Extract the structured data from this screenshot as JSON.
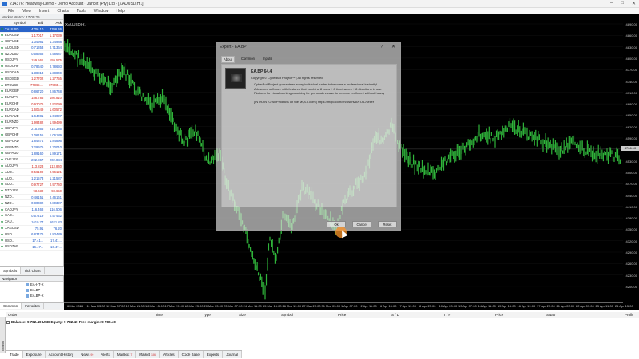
{
  "window": {
    "title": "214376: Headway-Demo - Demo Account - Jancet (Pty) Ltd - [XAUUSD,H1]",
    "controls": [
      "–",
      "□",
      "✕"
    ]
  },
  "menu": [
    "File",
    "View",
    "Insert",
    "Charts",
    "Tools",
    "Window",
    "Help"
  ],
  "market_watch": {
    "title": "Market Watch: 17:00:25",
    "headers": {
      "symbol": "Symbol",
      "bid": "Bid",
      "ask": "Ask"
    },
    "rows": [
      {
        "symbol": "XAUUSD",
        "bid": "4706.10",
        "ask": "4706.46",
        "dir": "sel"
      },
      {
        "symbol": "EURUSD",
        "bid": "1.17017",
        "ask": "1.17039",
        "dir": "down"
      },
      {
        "symbol": "GBPUSD",
        "bid": "1.34981",
        "ask": "1.34988",
        "dir": "up"
      },
      {
        "symbol": "AUDUSD",
        "bid": "0.71353",
        "ask": "0.71364",
        "dir": "up"
      },
      {
        "symbol": "NZDUSD",
        "bid": "0.58668",
        "ask": "0.58687",
        "dir": "up"
      },
      {
        "symbol": "USDJPY",
        "bid": "159.561",
        "ask": "159.575",
        "dir": "down"
      },
      {
        "symbol": "USDCHF",
        "bid": "0.78640",
        "ask": "0.78693",
        "dir": "up"
      },
      {
        "symbol": "USDCAD",
        "bid": "1.38813",
        "ask": "1.38849",
        "dir": "up"
      },
      {
        "symbol": "USDSGD",
        "bid": "1.27702",
        "ask": "1.27755",
        "dir": "down"
      },
      {
        "symbol": "BTCUSD",
        "bid": "77865....",
        "ask": "77903....",
        "dir": "down"
      },
      {
        "symbol": "EURGBP",
        "bid": "0.86720",
        "ask": "0.86748",
        "dir": "up"
      },
      {
        "symbol": "EURJPY",
        "bid": "186.785",
        "ask": "186.810",
        "dir": "down"
      },
      {
        "symbol": "EURCHF",
        "bid": "0.92076",
        "ask": "0.92099",
        "dir": "down"
      },
      {
        "symbol": "EURCAD",
        "bid": "1.60549",
        "ask": "1.60572",
        "dir": "down"
      },
      {
        "symbol": "EURAUD",
        "bid": "1.64081",
        "ask": "1.64097",
        "dir": "up"
      },
      {
        "symbol": "EURNZD",
        "bid": "1.99482",
        "ask": "1.99499",
        "dir": "down"
      },
      {
        "symbol": "GBPJPY",
        "bid": "215.366",
        "ask": "215.385",
        "dir": "up"
      },
      {
        "symbol": "GBPCHF",
        "bid": "1.06155",
        "ask": "1.06189",
        "dir": "up"
      },
      {
        "symbol": "GBPCAD",
        "bid": "1.84874",
        "ask": "1.84896",
        "dir": "up"
      },
      {
        "symbol": "GBPNZD",
        "bid": "2.29975",
        "ask": "2.30010",
        "dir": "up"
      },
      {
        "symbol": "GBPAUD",
        "bid": "1.89160",
        "ask": "1.89171",
        "dir": "up"
      },
      {
        "symbol": "CHFJPY",
        "bid": "202.867",
        "ask": "202.884",
        "dir": "up"
      },
      {
        "symbol": "AUDJPY",
        "bid": "113.823",
        "ask": "113.840",
        "dir": "down"
      },
      {
        "symbol": "AUD...",
        "bid": "0.56109",
        "ask": "0.56121",
        "dir": "down"
      },
      {
        "symbol": "AUD...",
        "bid": "1.21573",
        "ask": "1.21587",
        "dir": "up"
      },
      {
        "symbol": "AUD...",
        "bid": "0.97727",
        "ask": "0.97740",
        "dir": "down"
      },
      {
        "symbol": "NZDJPY",
        "bid": "93.630",
        "ask": "93.650",
        "dir": "down"
      },
      {
        "symbol": "NZD...",
        "bid": "0.46151",
        "ask": "0.46161",
        "dir": "up"
      },
      {
        "symbol": "NZD...",
        "bid": "0.80382",
        "ask": "0.80397",
        "dir": "up"
      },
      {
        "symbol": "CADJPY",
        "bid": "116.468",
        "ask": "116.506",
        "dir": "up"
      },
      {
        "symbol": "CAD...",
        "bid": "0.57419",
        "ask": "0.57432",
        "dir": "up"
      },
      {
        "symbol": "XAU...",
        "bid": "1619.77",
        "ask": "6621.83",
        "dir": "up"
      },
      {
        "symbol": "XAGUSD",
        "bid": "75.91",
        "ask": "76.20",
        "dir": "up"
      },
      {
        "symbol": "USD...",
        "bid": "6.83476",
        "ask": "6.83489",
        "dir": "up"
      },
      {
        "symbol": "USD...",
        "bid": "17.41...",
        "ask": "17.41...",
        "dir": "up"
      },
      {
        "symbol": "USDZAR",
        "bid": "16.47...",
        "ask": "16.47...",
        "dir": "up"
      }
    ],
    "tabs": [
      "Symbols",
      "Tick Chart"
    ]
  },
  "navigator": {
    "title": "Navigator",
    "items": [
      "EA-HT-X",
      "EA.BP",
      "EA.BP-X"
    ],
    "tabs": [
      "Common",
      "Favorites"
    ]
  },
  "chart": {
    "tab": "XAUUSD,H1",
    "y_labels": [
      "4890.00",
      "4860.00",
      "4830.00",
      "4800.00",
      "4770.00",
      "4740.00",
      "4710.00",
      "4680.00",
      "4650.00",
      "4620.00",
      "4590.00",
      "4560.00",
      "4530.00",
      "4500.00",
      "4470.00",
      "4440.00",
      "4410.00",
      "4380.00",
      "4350.00",
      "4320.00",
      "4290.00",
      "4260.00",
      "4230.00",
      "4200.00"
    ],
    "current_price": "4706.10",
    "x_labels": [
      "6 Mar 2026",
      "11 Mar 03:00",
      "12 Mar 07:00",
      "13 Mar 11:00",
      "16 Mar 15:00",
      "17 Mar 19:00",
      "18 Mar 23:00",
      "20 Mar 03:00",
      "23 Mar 07:00",
      "24 Mar 11:00",
      "25 Mar 15:00",
      "26 Mar 19:00",
      "27 Mar 23:00",
      "31 Mar 03:00",
      "1 Apr 07:00",
      "2 Apr 11:00",
      "6 Apr 15:00",
      "7 Apr 19:00",
      "8 Apr 23:00",
      "10 Apr 03:00",
      "13 Apr 07:00",
      "14 Apr 11:00",
      "15 Apr 15:00",
      "16 Apr 19:00",
      "17 Apr 23:00",
      "21 Apr 03:00",
      "22 Apr 07:00",
      "23 Apr 11:00",
      "24 Apr 15:00"
    ]
  },
  "dialog": {
    "title": "Expert - EA.BP",
    "help": "?",
    "close": "✕",
    "tabs": [
      "About",
      "Common",
      "Inputs"
    ],
    "ea_name": "EA.BP 64.4",
    "copyright": "Copyright© CyberBot Project™ | All rights reserved",
    "description": "CyberBot Project guarantees every individual trader to become a professional instantly! Advanced software with features that combine 8 pairs + 8 timeframes + 8 directions in one Platform for visual working coaching for personal release to become proficient without heavy",
    "link": "[INTRANTO All Products on the MQL5.com | https://mql5.com/en/users/ANTAL/seller",
    "buttons": {
      "ok": "Ok",
      "cancel": "Cancel",
      "reset": "Reset"
    }
  },
  "toolbox": {
    "columns": [
      "Order",
      "Time",
      "Type",
      "Size",
      "Symbol",
      "Price",
      "S / L",
      "T / P",
      "Price",
      "Swap",
      "Profit"
    ],
    "balance": "Balance: 9 782.40 USD  Equity: 9 782.40  Free margin: 9 782.40",
    "side_label": "Toolbox",
    "tabs": [
      {
        "label": "Trade",
        "badge": ""
      },
      {
        "label": "Exposure",
        "badge": ""
      },
      {
        "label": "Account History",
        "badge": ""
      },
      {
        "label": "News",
        "badge": "99"
      },
      {
        "label": "Alerts",
        "badge": ""
      },
      {
        "label": "Mailbox",
        "badge": "7"
      },
      {
        "label": "Market",
        "badge": "186"
      },
      {
        "label": "Articles",
        "badge": ""
      },
      {
        "label": "Code Base",
        "badge": ""
      },
      {
        "label": "Experts",
        "badge": ""
      },
      {
        "label": "Journal",
        "badge": ""
      }
    ]
  },
  "colors": {
    "candle": "#2fb33a",
    "chart_bg": "#000000",
    "selected_row": "#2a64c9",
    "down": "#d12a20",
    "up": "#1d58c7"
  }
}
